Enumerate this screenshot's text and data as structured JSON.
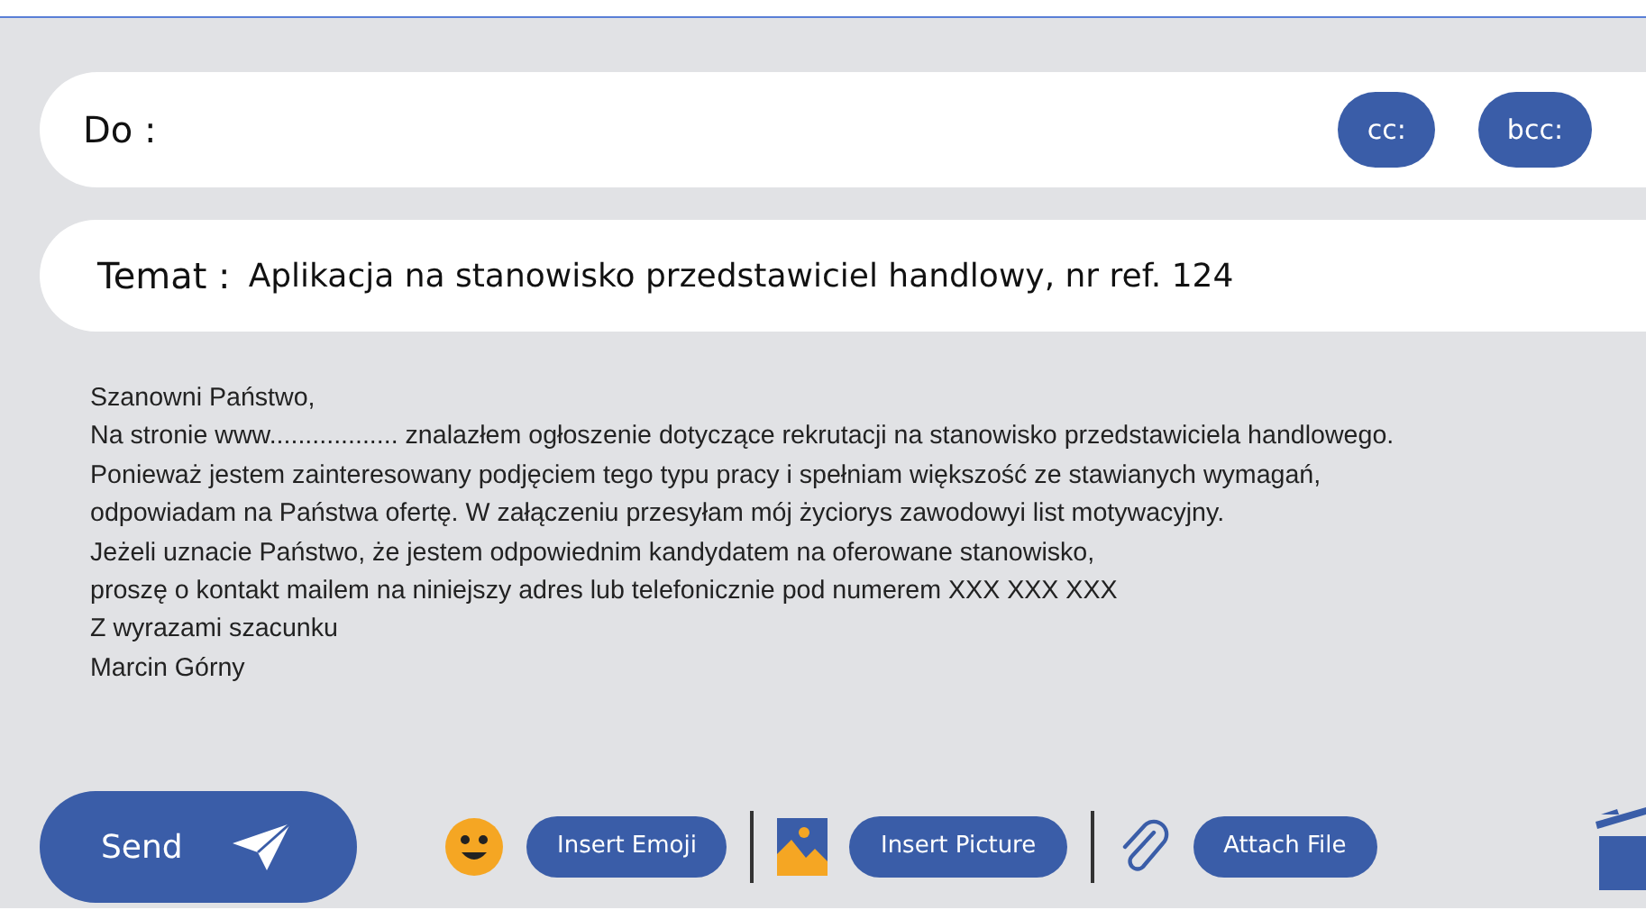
{
  "to": {
    "label": "Do :",
    "buttons": [
      "cc:",
      "bcc:"
    ]
  },
  "subject": {
    "label": "Temat :",
    "value": "Aplikacja na stanowisko przedstawiciel handlowy, nr ref. 124"
  },
  "body": {
    "lines": [
      "Szanowni Państwo,",
      "Na stronie www.................. znalazłem ogłoszenie dotyczące rekrutacji na stanowisko przedstawiciela handlowego.",
      "Ponieważ jestem zainteresowany podjęciem tego typu pracy i spełniam większość ze stawianych wymagań,",
      "odpowiadam na Państwa ofertę. W załączeniu przesyłam mój życiorys zawodowyi list motywacyjny.",
      "Jeżeli uznacie Państwo, że jestem odpowiednim kandydatem na oferowane stanowisko,",
      "proszę o kontakt mailem na niniejszy adres lub telefonicznie pod numerem XXX XXX XXX",
      "Z wyrazami szacunku",
      "Marcin Górny"
    ]
  },
  "toolbar": {
    "send": "Send",
    "actions": [
      {
        "kind": "emoji",
        "label": "Insert Emoji"
      },
      {
        "kind": "picture",
        "label": "Insert Picture"
      },
      {
        "kind": "attach",
        "label": "Attach File"
      }
    ]
  }
}
